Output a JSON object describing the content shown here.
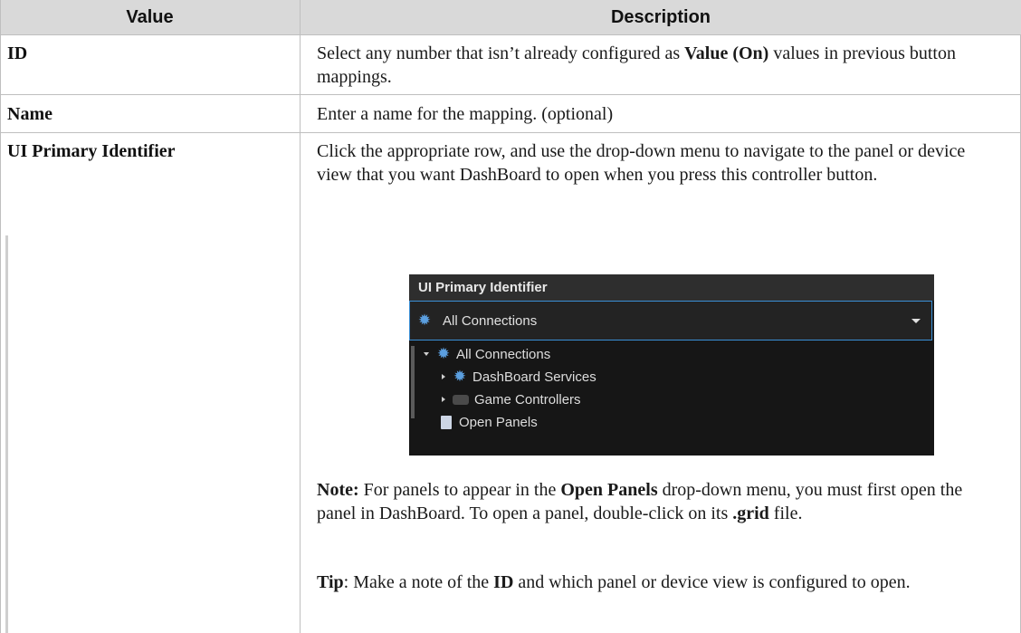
{
  "table": {
    "headers": {
      "value": "Value",
      "description": "Description"
    },
    "rows": [
      {
        "key": "ID",
        "desc_parts": [
          "Select any number that isn’t already configured as ",
          "Value (On)",
          " values in previous button mappings."
        ]
      },
      {
        "key": "Name",
        "desc": "Enter a name for the mapping. (optional)"
      },
      {
        "key": "UI Primary Identifier",
        "desc": "Click the appropriate row, and use the drop-down menu to navigate to the panel or device view that you want DashBoard to open when you press this controller button.",
        "note": {
          "label": "Note:",
          "part1": " For panels to appear in the ",
          "bold1": "Open Panels",
          "part2": " drop-down menu, you must first open the panel in DashBoard. To open a panel, double-click on its ",
          "bold2": ".grid",
          "part3": " file."
        },
        "tip": {
          "label": "Tip",
          "part1": ": Make a note of the ",
          "bold1": "ID",
          "part2": " and which panel or device view is configured to open."
        }
      }
    ]
  },
  "screenshot": {
    "title": "UI Primary Identifier",
    "selected": "All Connections",
    "tree": [
      {
        "label": "All Connections",
        "icon": "gear-icon",
        "expander": "expanded"
      },
      {
        "label": "DashBoard Services",
        "icon": "gear-icon",
        "expander": "collapsed"
      },
      {
        "label": "Game Controllers",
        "icon": "gamepad-icon",
        "expander": "collapsed"
      },
      {
        "label": "Open Panels",
        "icon": "page-icon",
        "expander": "none"
      }
    ]
  }
}
